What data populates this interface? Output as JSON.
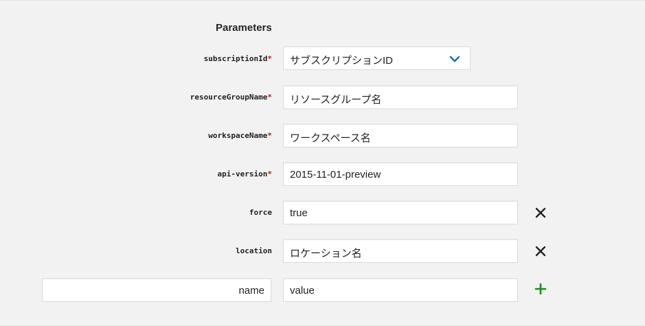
{
  "section_title": "Parameters",
  "required_marker": "*",
  "params": {
    "subscription": {
      "label": "subscriptionId",
      "value": "サブスクリプションID"
    },
    "resource_group": {
      "label": "resourceGroupName",
      "value": "リソースグループ名"
    },
    "workspace": {
      "label": "workspaceName",
      "value": "ワークスペース名"
    },
    "api_version": {
      "label": "api-version",
      "value": "2015-11-01-preview"
    },
    "force": {
      "label": "force",
      "value": "true"
    },
    "location": {
      "label": "location",
      "value": "ロケーション名"
    }
  },
  "new_param": {
    "name_placeholder": "name",
    "value_placeholder": "value"
  },
  "colors": {
    "accent_blue": "#1a6fb5",
    "required_red": "#c41a1a",
    "add_green": "#1e8a1e"
  },
  "icons": {
    "dropdown": "chevron-down-icon",
    "remove": "close-icon",
    "add": "plus-icon"
  }
}
